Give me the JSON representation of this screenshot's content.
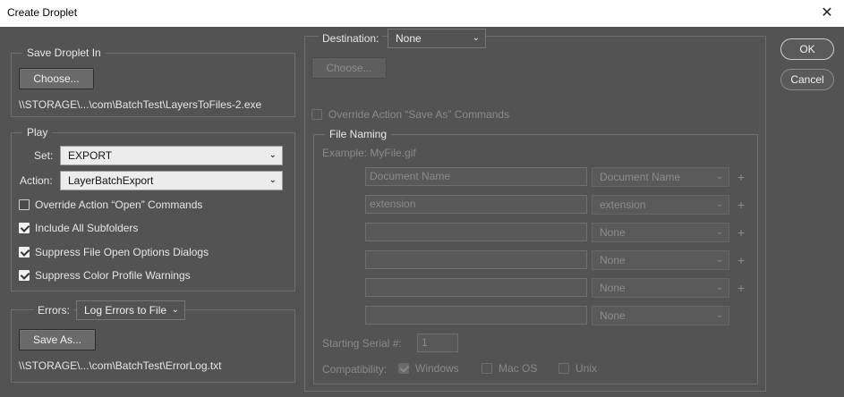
{
  "window": {
    "title": "Create Droplet",
    "close_glyph": "✕"
  },
  "save_droplet": {
    "legend": "Save Droplet In",
    "choose_label": "Choose...",
    "path": "\\\\STORAGE\\...\\com\\BatchTest\\LayersToFiles-2.exe"
  },
  "play": {
    "legend": "Play",
    "set_label": "Set:",
    "set_value": "EXPORT",
    "action_label": "Action:",
    "action_value": "LayerBatchExport",
    "options": [
      {
        "label": "Override Action “Open” Commands",
        "checked": false
      },
      {
        "label": "Include All Subfolders",
        "checked": true
      },
      {
        "label": "Suppress File Open Options Dialogs",
        "checked": true
      },
      {
        "label": "Suppress Color Profile Warnings",
        "checked": true
      }
    ]
  },
  "errors": {
    "label": "Errors:",
    "value": "Log Errors to File",
    "save_as_label": "Save As...",
    "path": "\\\\STORAGE\\...\\com\\BatchTest\\ErrorLog.txt"
  },
  "destination": {
    "label": "Destination:",
    "value": "None",
    "choose_label": "Choose...",
    "override_label": "Override Action “Save As” Commands",
    "override_checked": false
  },
  "file_naming": {
    "legend": "File Naming",
    "example": "Example: MyFile.gif",
    "rows": [
      {
        "text": "Document Name",
        "select": "Document Name",
        "plus": "+"
      },
      {
        "text": "extension",
        "select": "extension",
        "plus": "+"
      },
      {
        "text": "",
        "select": "None",
        "plus": "+"
      },
      {
        "text": "",
        "select": "None",
        "plus": "+"
      },
      {
        "text": "",
        "select": "None",
        "plus": "+"
      },
      {
        "text": "",
        "select": "None",
        "plus": ""
      }
    ],
    "serial_label": "Starting Serial #:",
    "serial_value": "1",
    "compat_label": "Compatibility:",
    "compat": [
      {
        "label": "Windows",
        "checked": true
      },
      {
        "label": "Mac OS",
        "checked": false
      },
      {
        "label": "Unix",
        "checked": false
      }
    ]
  },
  "actions": {
    "ok_label": "OK",
    "cancel_label": "Cancel"
  },
  "colors": {
    "panel": "#535353",
    "titlebar": "#ffffff",
    "text": "#e6e6e6",
    "disabled_text": "#8a8a8a"
  },
  "icons": {
    "close": "close-icon",
    "dropdown": "chevron-down-icon",
    "check": "checkmark-icon"
  }
}
